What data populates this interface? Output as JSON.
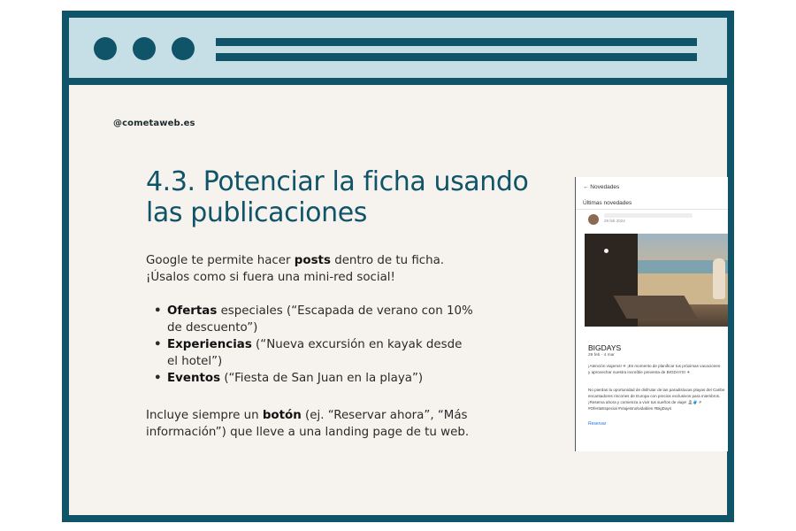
{
  "handle": "@cometaweb.es",
  "title": "4.3. Potenciar la ficha usando las publicaciones",
  "intro": {
    "before": "Google te permite hacer ",
    "bold": "posts",
    "after": " dentro de tu ficha. ¡Úsalos como si fuera una mini-red social!"
  },
  "bullets": [
    {
      "bold": "Ofertas",
      "rest": " especiales (“Escapada de verano con 10% de descuento”)"
    },
    {
      "bold": "Experiencias",
      "rest": " (“Nueva excursión en kayak desde el hotel”)"
    },
    {
      "bold": "Eventos",
      "rest": " (“Fiesta de San Juan en la playa”)"
    }
  ],
  "outro": {
    "before": "Incluye siempre un ",
    "bold": "botón",
    "after": " (ej. “Reservar ahora”, “Más información”) que lleve a una landing page de tu web."
  },
  "post_preview": {
    "header": "←  Novedades",
    "subheader": "Últimas novedades",
    "date": "29 feb 2024",
    "title": "BIGDAYS",
    "meta": "29 feb - 4 mar",
    "desc1": "¡Atención viajeros! ✈ ¡Es momento de planificar tus próximas vacaciones\ny aprovechar nuestra increíble preventa de BIGDAYS! ☀",
    "desc2": "No pierdas la oportunidad de disfrutar de las paradisíacas playas del Caribe\nencantadores rincones de Europa con precios exclusivos para miembros.\n¡Reserva ahora y comienza a vivir tus sueños de viaje! 🏝🧳 #\n#OfertaEspecial #ViajesInolvidables #BigDays",
    "cta": "Reservar"
  },
  "colors": {
    "frame": "#0f5468",
    "titlebar": "#c6dfe6",
    "page": "#f6f3ee"
  }
}
